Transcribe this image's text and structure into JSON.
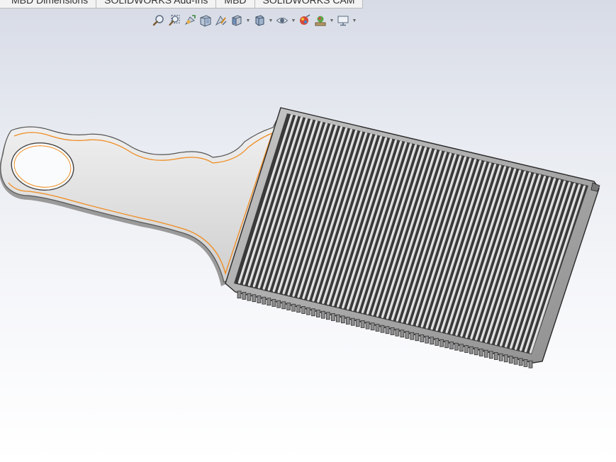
{
  "tabs": [
    {
      "label": "MBD Dimensions"
    },
    {
      "label": "SOLIDWORKS Add-Ins"
    },
    {
      "label": "MBD"
    },
    {
      "label": "SOLIDWORKS CAM"
    }
  ],
  "heads_up_toolbar": [
    {
      "icon": "zoom-to-fit-icon"
    },
    {
      "icon": "zoom-to-area-icon"
    },
    {
      "icon": "previous-view-icon"
    },
    {
      "icon": "section-view-icon"
    },
    {
      "icon": "dynamic-annotation-views-icon"
    },
    {
      "icon": "view-orientation-icon",
      "dropdown": true
    },
    {
      "icon": "display-style-icon",
      "dropdown": true
    },
    {
      "icon": "hide-show-items-icon",
      "dropdown": true
    },
    {
      "icon": "edit-appearance-icon"
    },
    {
      "icon": "apply-scene-icon",
      "dropdown": true
    },
    {
      "icon": "view-settings-icon",
      "dropdown": true
    }
  ],
  "model": {
    "part": "comb",
    "highlight_color": "#f08a1c",
    "body_color": "#d9d9d9"
  }
}
